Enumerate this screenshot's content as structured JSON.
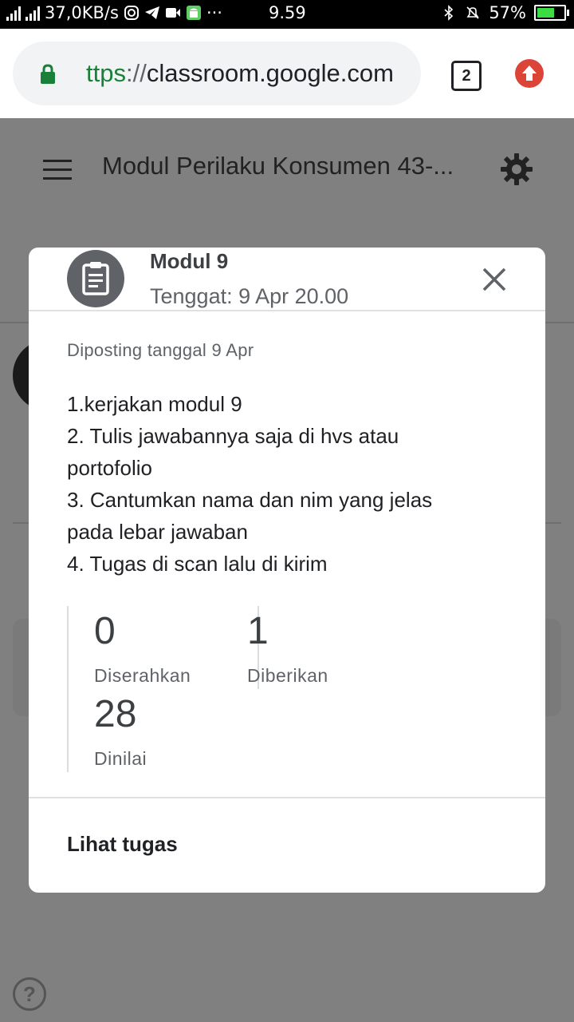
{
  "status_bar": {
    "network_speed": "37,0KB/s",
    "dots": "···",
    "time": "9.59",
    "battery": "57%",
    "battery_level": 0.57
  },
  "browser": {
    "url_scheme": "ttps",
    "url_sep": "://",
    "url_host": "classroom.google.com",
    "tab_count": "2"
  },
  "page": {
    "title": "Modul Perilaku Konsumen 43-..."
  },
  "dialog": {
    "title": "Modul 9",
    "due": "Tenggat: 9 Apr 20.00",
    "posted": "Diposting tanggal 9 Apr",
    "instructions": [
      "1.kerjakan modul 9",
      "2. Tulis jawabannya saja di hvs atau",
      "portofolio",
      "3. Cantumkan nama dan nim yang jelas",
      "pada lebar jawaban",
      "4. Tugas di scan lalu di kirim"
    ],
    "stats": {
      "submitted_count": "0",
      "submitted_label": "Diserahkan",
      "assigned_count": "1",
      "assigned_label": "Diberikan",
      "graded_count": "28",
      "graded_label": "Dinilai"
    },
    "view_link": "Lihat tugas"
  },
  "icons": [
    "signal-icon",
    "instagram-icon",
    "telegram-icon",
    "video-icon",
    "android-icon",
    "bluetooth-icon",
    "mute-icon",
    "battery-icon",
    "lock-icon",
    "upload-icon",
    "menu-icon",
    "gear-icon",
    "assignment-icon",
    "close-icon",
    "help-icon"
  ],
  "colors": {
    "secure_green": "#188038",
    "upload_red": "#db4437",
    "scrim": "#808080",
    "battery_green": "#3ddc45"
  }
}
